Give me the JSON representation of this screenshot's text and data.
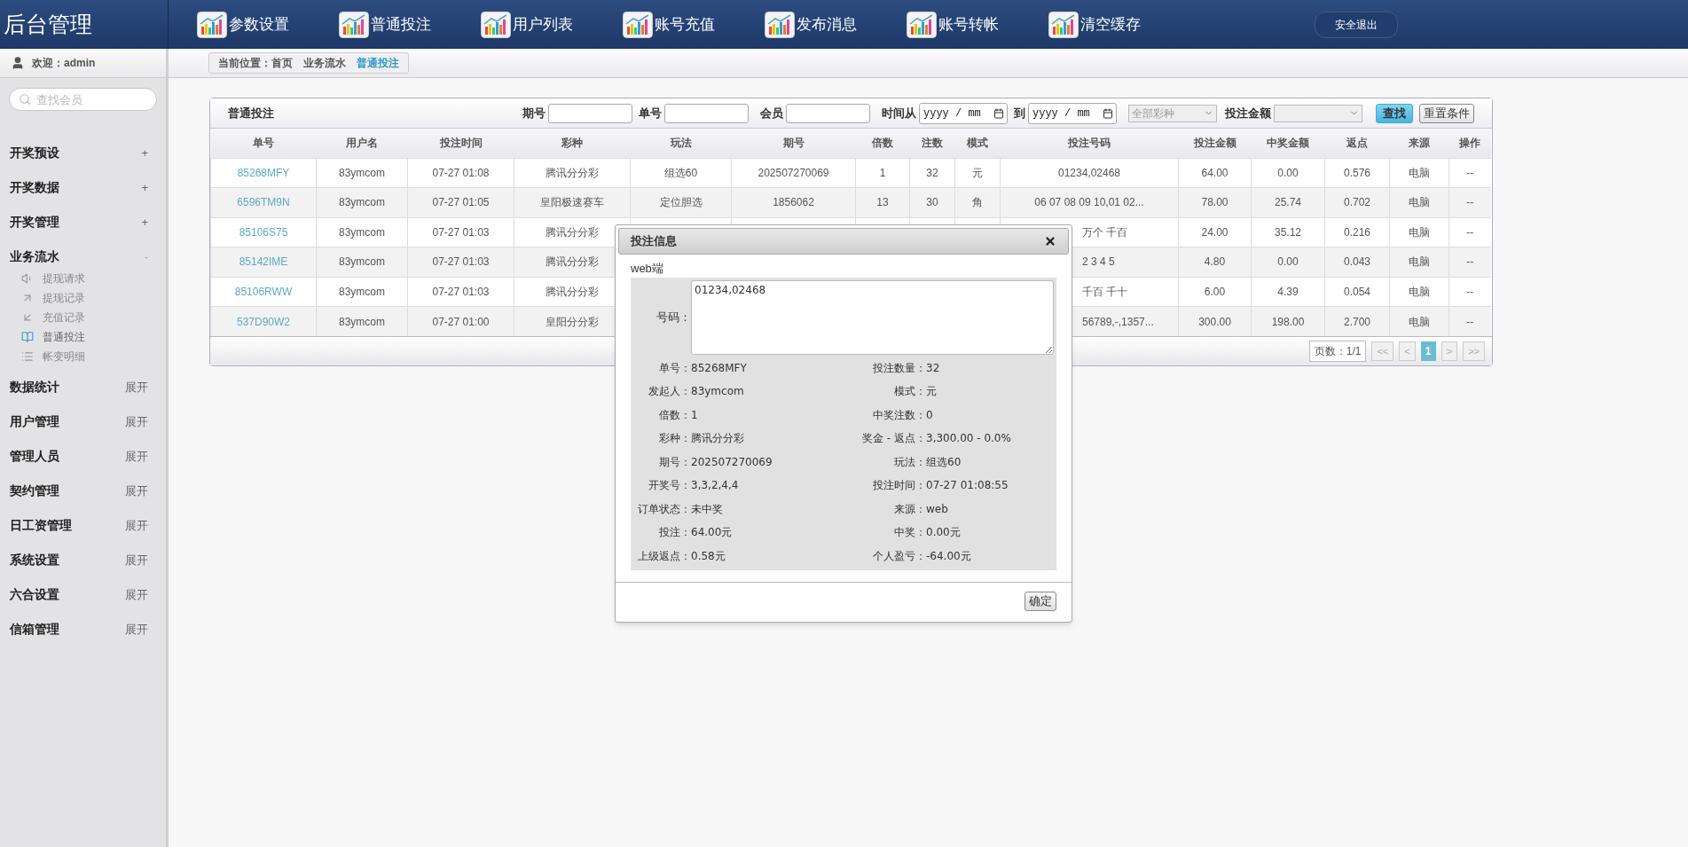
{
  "header": {
    "title": "后台管理",
    "nav": [
      "参数设置",
      "普通投注",
      "用户列表",
      "账号充值",
      "发布消息",
      "账号转帐",
      "清空缓存"
    ],
    "logout": "安全退出"
  },
  "sidebar": {
    "welcome": "欢迎：admin",
    "search_placeholder": "查找会员",
    "groups": [
      {
        "label": "开奖预设",
        "toggle": "+",
        "expanded": false
      },
      {
        "label": "开奖数据",
        "toggle": "+",
        "expanded": false
      },
      {
        "label": "开奖管理",
        "toggle": "+",
        "expanded": false
      },
      {
        "label": "业务流水",
        "toggle": "-",
        "expanded": true,
        "children": [
          {
            "label": "提现请求",
            "kind": "speaker",
            "selected": false
          },
          {
            "label": "提现记录",
            "kind": "out",
            "selected": false
          },
          {
            "label": "充值记录",
            "kind": "in",
            "selected": false
          },
          {
            "label": "普通投注",
            "kind": "book",
            "selected": true
          },
          {
            "label": "帐变明细",
            "kind": "list",
            "selected": false
          }
        ]
      },
      {
        "label": "数据统计",
        "toggle": "展开",
        "expanded": false
      },
      {
        "label": "用户管理",
        "toggle": "展开",
        "expanded": false
      },
      {
        "label": "管理人员",
        "toggle": "展开",
        "expanded": false
      },
      {
        "label": "契约管理",
        "toggle": "展开",
        "expanded": false
      },
      {
        "label": "日工资管理",
        "toggle": "展开",
        "expanded": false
      },
      {
        "label": "系统设置",
        "toggle": "展开",
        "expanded": false
      },
      {
        "label": "六合设置",
        "toggle": "展开",
        "expanded": false
      },
      {
        "label": "信箱管理",
        "toggle": "展开",
        "expanded": false
      }
    ]
  },
  "breadcrumb": [
    {
      "label": "当前位置：首页",
      "selected": false
    },
    {
      "label": "业务流水",
      "selected": false
    },
    {
      "label": "普通投注",
      "selected": true
    }
  ],
  "filter": {
    "title": "普通投注",
    "issue_label": "期号",
    "order_label": "单号",
    "member_label": "会员",
    "time_from_label": "时间从",
    "date_from_placeholder": "yyyy / mm",
    "to_label": "到",
    "date_to_placeholder": "yyyy / mm",
    "lottery_select": "全部彩种",
    "amount_label": "投注金额",
    "search_button": "查找",
    "reset_button": "重置条件"
  },
  "table": {
    "columns": [
      "单号",
      "用户名",
      "投注时间",
      "彩种",
      "玩法",
      "期号",
      "倍数",
      "注数",
      "模式",
      "投注号码",
      "投注金额",
      "中奖金额",
      "返点",
      "来源",
      "操作"
    ],
    "rows": [
      {
        "order": "85268MFY",
        "user": "83ymcom",
        "time": "07-27 01:08",
        "lottery": "腾讯分分彩",
        "play": "组选60",
        "issue": "202507270069",
        "multiple": "1",
        "count": "32",
        "mode": "元",
        "numbers": "01234,02468",
        "amount": "64.00",
        "win": "0.00",
        "rebate": "0.576",
        "source": "电脑",
        "action": "--"
      },
      {
        "order": "6596TM9N",
        "user": "83ymcom",
        "time": "07-27 01:05",
        "lottery": "皇阳极速赛车",
        "play": "定位胆选",
        "issue": "1856062",
        "multiple": "13",
        "count": "30",
        "mode": "角",
        "numbers": "06 07 08 09 10,01 02...",
        "amount": "78.00",
        "win": "25.74",
        "rebate": "0.702",
        "source": "电脑",
        "action": "--"
      },
      {
        "order": "85106S75",
        "user": "83ymcom",
        "time": "07-27 01:03",
        "lottery": "腾讯分分彩",
        "numbers": "万个 千百",
        "amount": "24.00",
        "win": "35.12",
        "rebate": "0.216",
        "source": "电脑",
        "action": "--"
      },
      {
        "order": "85142IME",
        "user": "83ymcom",
        "time": "07-27 01:03",
        "lottery": "腾讯分分彩",
        "numbers": "2 3 4 5",
        "amount": "4.80",
        "win": "0.00",
        "rebate": "0.043",
        "source": "电脑",
        "action": "--"
      },
      {
        "order": "85106RWW",
        "user": "83ymcom",
        "time": "07-27 01:03",
        "lottery": "腾讯分分彩",
        "numbers": "千百 千十",
        "amount": "6.00",
        "win": "4.39",
        "rebate": "0.054",
        "source": "电脑",
        "action": "--"
      },
      {
        "order": "537D90W2",
        "user": "83ymcom",
        "time": "07-27 01:00",
        "lottery": "皇阳分分彩",
        "numbers": "56789,-,1357...",
        "amount": "300.00",
        "win": "198.00",
        "rebate": "2.700",
        "source": "电脑",
        "action": "--"
      }
    ]
  },
  "pagination": {
    "pages": "页数：1/1",
    "buttons": [
      {
        "label": "<<",
        "selected": false
      },
      {
        "label": "<",
        "selected": false
      },
      {
        "label": "1",
        "selected": true
      },
      {
        "label": ">",
        "selected": false
      },
      {
        "label": ">>",
        "selected": false
      }
    ]
  },
  "modal": {
    "title": "投注信息",
    "source_note": "web端",
    "code_label": "号码：",
    "code_value": "01234,02468",
    "details": [
      {
        "label": "单号：",
        "value": "85268MFY"
      },
      {
        "label": "投注数量：",
        "value": "32"
      },
      {
        "label": "发起人：",
        "value": "83ymcom"
      },
      {
        "label": "模式：",
        "value": "元"
      },
      {
        "label": "倍数：",
        "value": "1"
      },
      {
        "label": "中奖注数：",
        "value": "0"
      },
      {
        "label": "彩种：",
        "value": "腾讯分分彩"
      },
      {
        "label": "奖金 - 返点：",
        "value": "3,300.00 - 0.0%"
      },
      {
        "label": "期号：",
        "value": "202507270069"
      },
      {
        "label": "玩法：",
        "value": "组选60"
      },
      {
        "label": "开奖号：",
        "value": "3,3,2,4,4"
      },
      {
        "label": "投注时间：",
        "value": "07-27 01:08:55"
      },
      {
        "label": "订单状态：",
        "value": "未中奖"
      },
      {
        "label": "来源：",
        "value": "web"
      },
      {
        "label": "投注：",
        "value": "64.00元"
      },
      {
        "label": "中奖：",
        "value": "0.00元"
      },
      {
        "label": "上级返点：",
        "value": "0.58元"
      },
      {
        "label": "个人盈亏：",
        "value": "-64.00元"
      }
    ],
    "ok_button": "确定"
  }
}
